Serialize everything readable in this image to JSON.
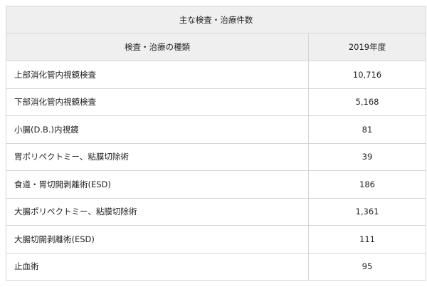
{
  "table": {
    "title": "主な検査・治療件数",
    "headers": [
      "検査・治療の種類",
      "2019年度"
    ],
    "rows": [
      {
        "name": "上部消化管内視鏡検査",
        "count": "10,716"
      },
      {
        "name": "下部消化管内視鏡検査",
        "count": "5,168"
      },
      {
        "name": "小腸(D.B.)内視鏡",
        "count": "81"
      },
      {
        "name": "胃ポリペクトミー、粘膜切除術",
        "count": "39"
      },
      {
        "name": "食道・胃切開剥離術(ESD)",
        "count": "186"
      },
      {
        "name": "大腸ポリペクトミー、粘膜切除術",
        "count": "1,361"
      },
      {
        "name": "大腸切開剥離術(ESD)",
        "count": "111"
      },
      {
        "name": "止血術",
        "count": "95"
      }
    ]
  }
}
